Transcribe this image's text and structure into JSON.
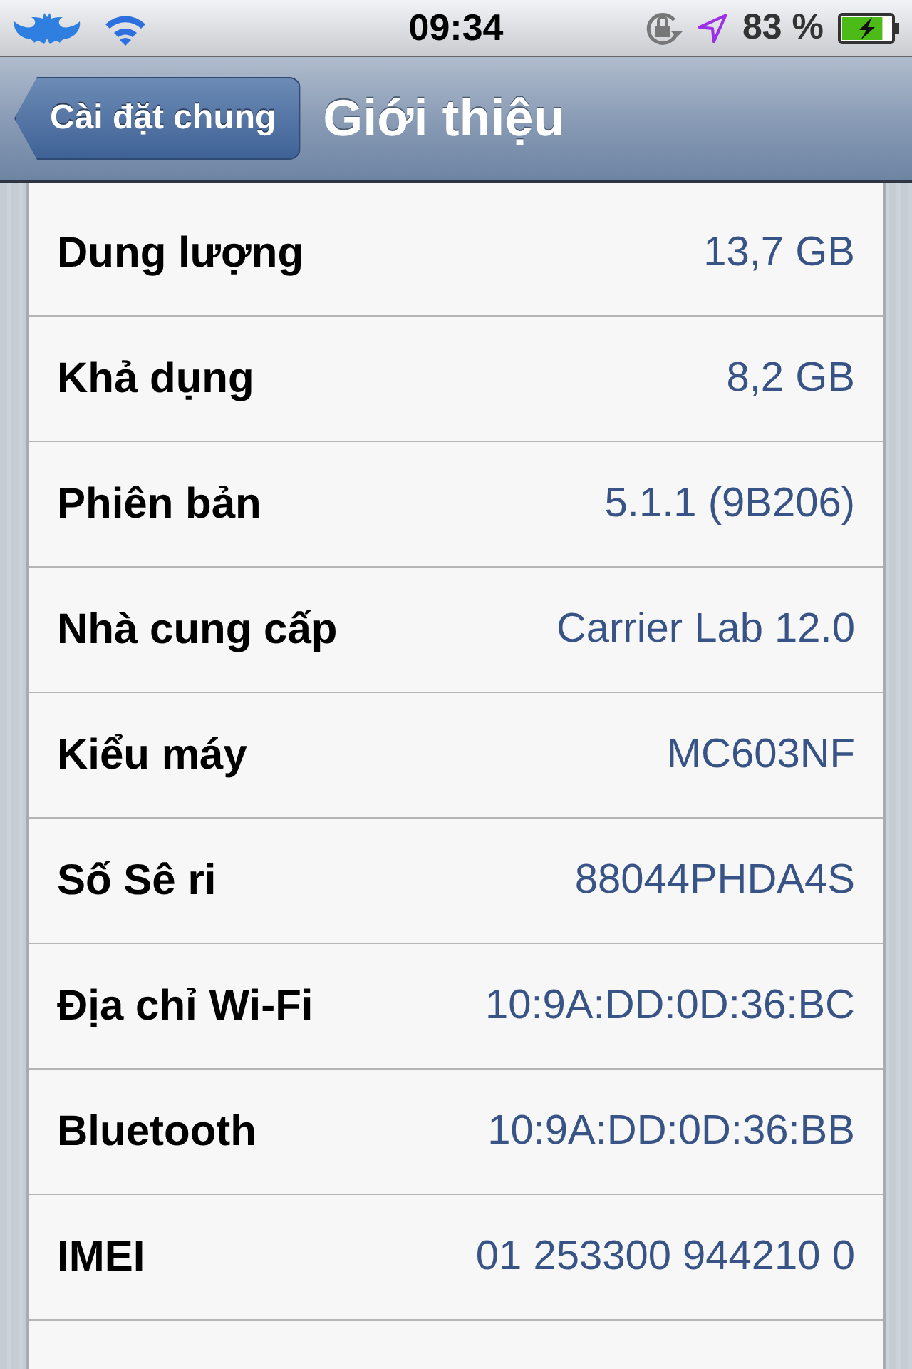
{
  "status_bar": {
    "time": "09:34",
    "battery": "83 %",
    "charging": true
  },
  "nav_bar": {
    "back_button": "Cài đặt chung",
    "title": "Giới thiệu"
  },
  "rows": [
    {
      "label": "Dung lượng",
      "value": "13,7 GB"
    },
    {
      "label": "Khả dụng",
      "value": "8,2 GB"
    },
    {
      "label": "Phiên bản",
      "value": "5.1.1 (9B206)"
    },
    {
      "label": "Nhà cung cấp",
      "value": "Carrier Lab 12.0"
    },
    {
      "label": "Kiểu máy",
      "value": "MC603NF"
    },
    {
      "label": "Số Sê ri",
      "value": "88044PHDA4S"
    },
    {
      "label": "Địa chỉ Wi-Fi",
      "value": "10:9A:DD:0D:36:BC"
    },
    {
      "label": "Bluetooth",
      "value": "10:9A:DD:0D:36:BB"
    },
    {
      "label": "IMEI",
      "value": "01 253300 944210 0"
    }
  ]
}
